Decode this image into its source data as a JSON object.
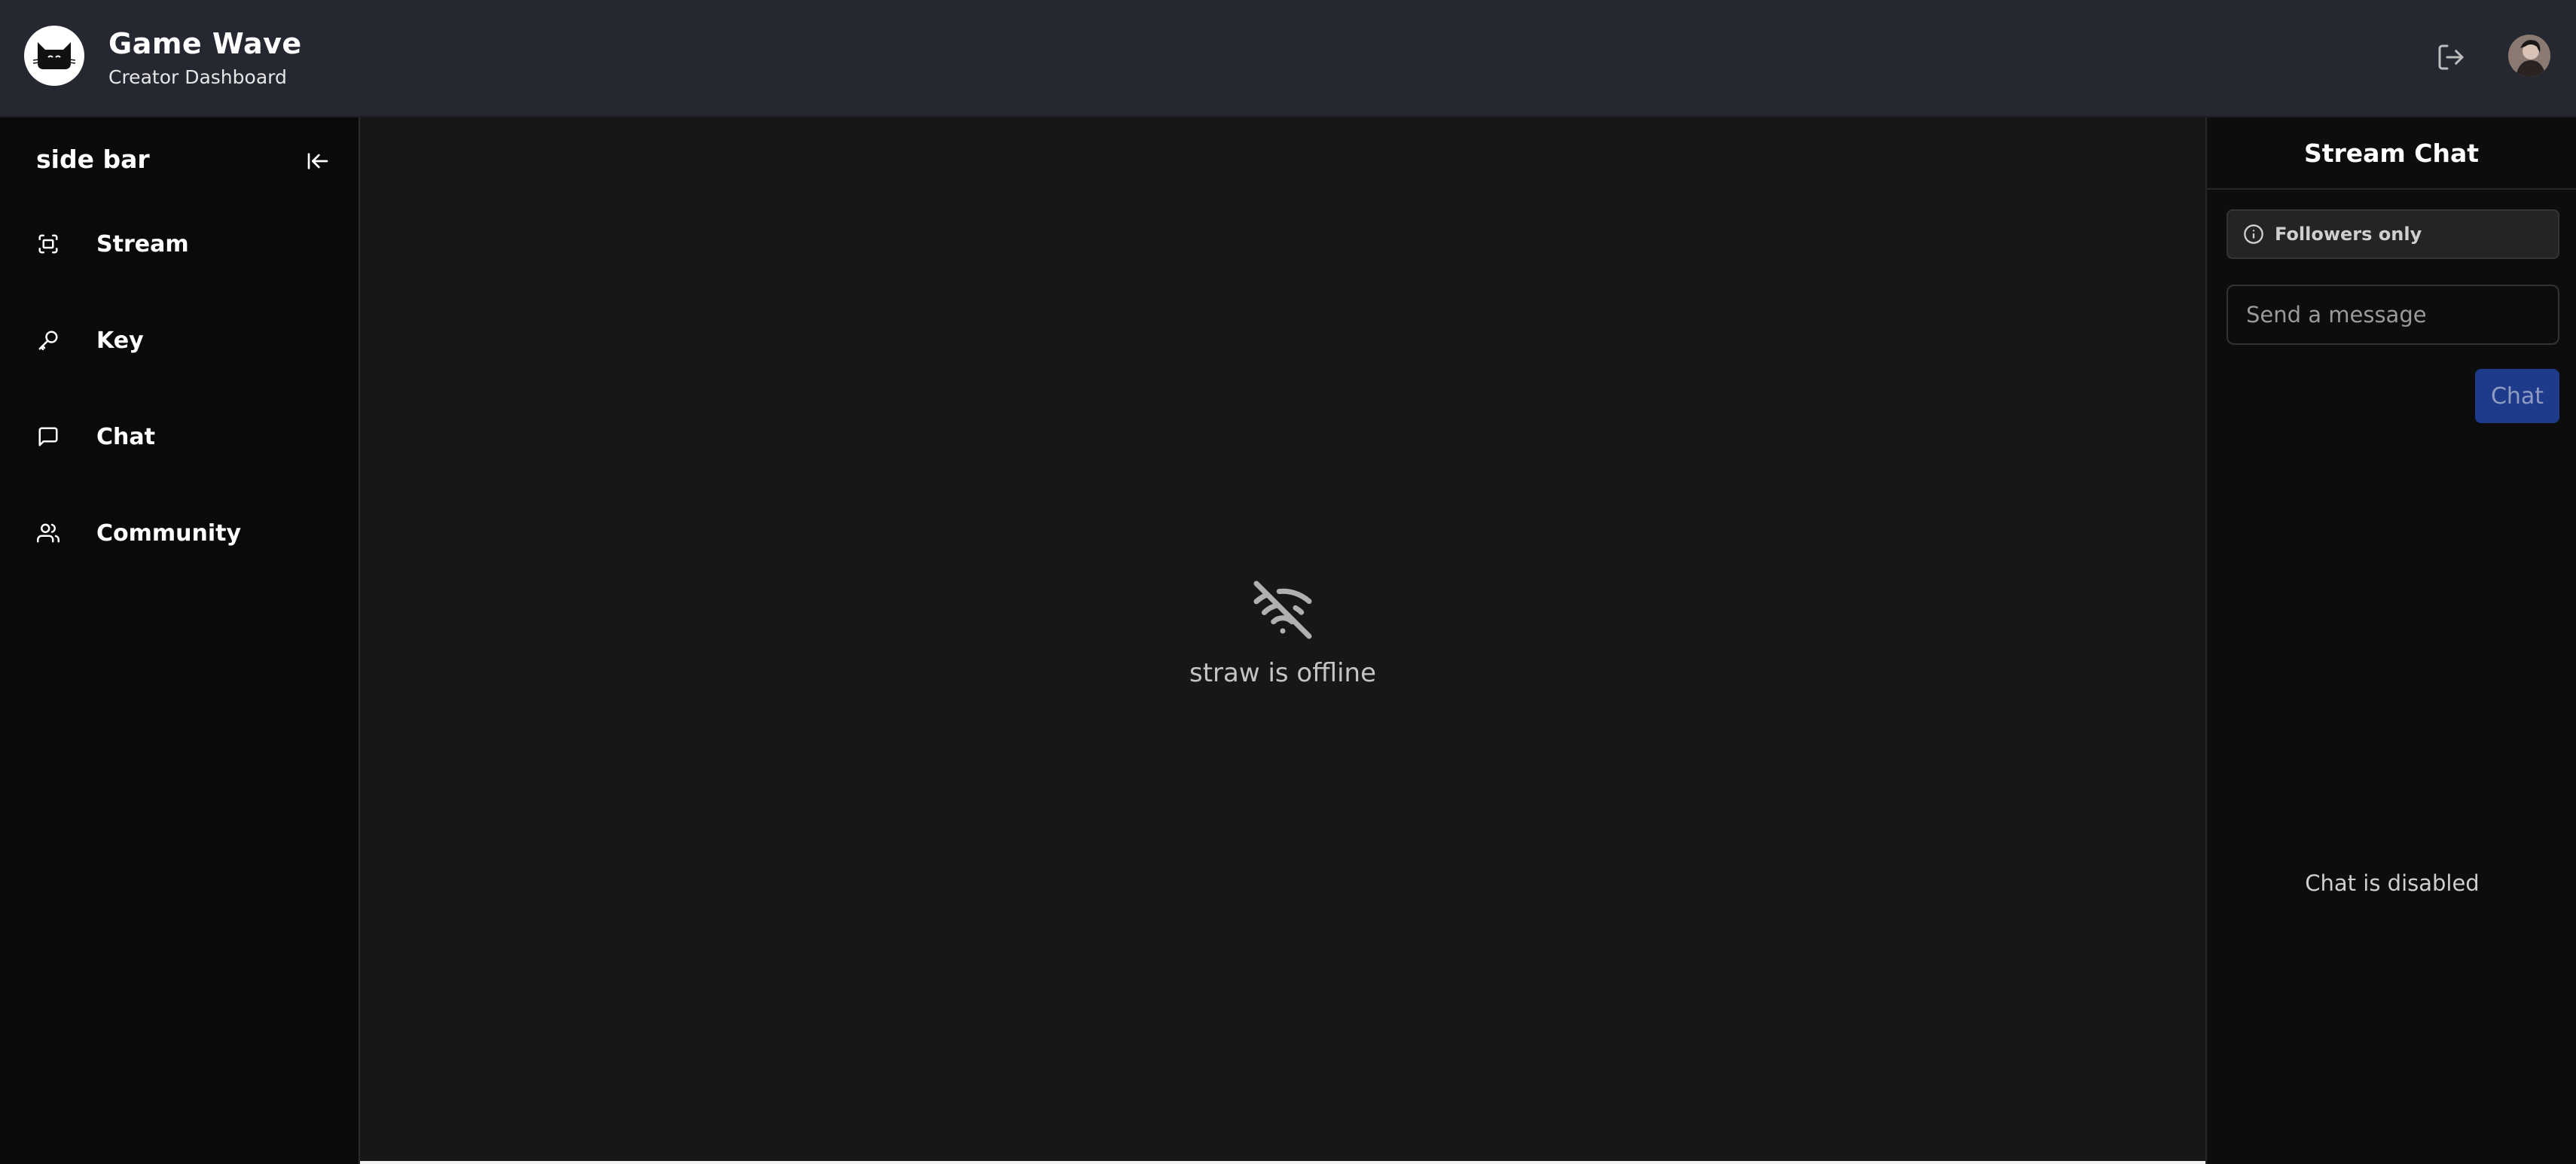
{
  "header": {
    "title": "Game Wave",
    "subtitle": "Creator Dashboard",
    "logout_icon": "logout-icon",
    "avatar": "user-avatar"
  },
  "sidebar": {
    "title": "side bar",
    "collapse_icon": "arrow-left-to-line-icon",
    "items": [
      {
        "label": "Stream",
        "icon": "fullscreen-icon"
      },
      {
        "label": "Key",
        "icon": "key-icon"
      },
      {
        "label": "Chat",
        "icon": "message-square-icon"
      },
      {
        "label": "Community",
        "icon": "users-icon"
      }
    ]
  },
  "main": {
    "offline_icon": "wifi-off-icon",
    "offline_text": "straw is offline"
  },
  "chat": {
    "title": "Stream Chat",
    "followers_label": "Followers only",
    "input_placeholder": "Send a message",
    "send_label": "Chat",
    "disabled_text": "Chat is disabled"
  },
  "colors": {
    "topbar": "#252731",
    "sidebar": "#0a0a0a",
    "main": "#171717",
    "chat_button": "#1e3a8a"
  }
}
